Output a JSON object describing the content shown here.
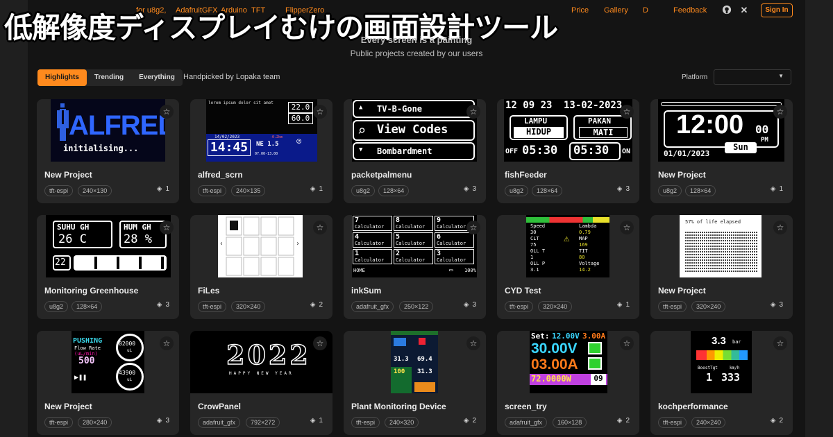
{
  "banner": {
    "text": "低解像度ディスプレイむけの画面設計ツール"
  },
  "nav": {
    "links": [
      "AdafruitGFX",
      "Arduino",
      "TFT",
      "FlipperZero",
      "Price",
      "Gallery",
      "Docs",
      "Feedback"
    ],
    "frag_left": "for u8g2,",
    "frag_docs": "D",
    "github": "github-icon",
    "x": "x-icon",
    "signin": "Sign In"
  },
  "hero": {
    "title": "Every screen is a painting",
    "subtitle": "Public projects created by our users"
  },
  "filters": {
    "tabs": [
      "Highlights",
      "Trending",
      "Everything"
    ],
    "active_tab": "Highlights",
    "caption": "Handpicked by Lopaka team",
    "platform_label": "Platform",
    "platform_value": ""
  },
  "colors": {
    "accent": "#ff8a1d",
    "background": "#141414",
    "card": "#262626"
  },
  "projects": [
    {
      "title": "New Project",
      "lib": "tft-espi",
      "size": "240×130",
      "count": "1",
      "screen": {
        "logo": "ALFRED",
        "sub": "initialising..."
      }
    },
    {
      "title": "alfred_scrn",
      "lib": "tft-espi",
      "size": "240×135",
      "count": "1",
      "screen": {
        "header": "lorem ipsum dolor sit amet",
        "v1": "22.0",
        "v2": "60.0",
        "date": "14/02/2023",
        "time": "14:45",
        "dir": "NE 1.5",
        "temp": "-0.2km",
        "range": "07.00-13.00"
      }
    },
    {
      "title": "packetpalmenu",
      "lib": "u8g2",
      "size": "128×64",
      "count": "3",
      "screen": {
        "items": [
          "TV-B-Gone",
          "View Codes",
          "Bombardment"
        ]
      }
    },
    {
      "title": "fishFeeder",
      "lib": "u8g2",
      "size": "128×64",
      "count": "3",
      "screen": {
        "time": "12 09 23",
        "date": "13-02-2023",
        "lamp": "LAMPU",
        "lamp_state": "HIDUP",
        "feed": "PAKAN",
        "feed_state": "MATI",
        "off_label": "OFF",
        "off_time": "05:30",
        "on_time": "05:30",
        "on_label": "ON"
      }
    },
    {
      "title": "New Project",
      "lib": "u8g2",
      "size": "128×64",
      "count": "1",
      "screen": {
        "time": "12:00",
        "sec": "00",
        "ampm": "PM",
        "date": "01/01/2023",
        "day": "Sun"
      }
    },
    {
      "title": "Monitoring Greenhouse",
      "lib": "u8g2",
      "size": "128×64",
      "count": "3",
      "screen": {
        "suhu": "SUHU GH",
        "suhu_val": "26 C",
        "hum": "HUM GH",
        "hum_val": "28 %",
        "num": "22"
      }
    },
    {
      "title": "FiLes",
      "lib": "tft-espi",
      "size": "320×240",
      "count": "2",
      "screen": {
        "prev": "‹",
        "next": "›"
      }
    },
    {
      "title": "inkSum",
      "lib": "adafruit_gfx",
      "size": "250×122",
      "count": "3",
      "screen": {
        "cells": [
          [
            "7",
            "Calculator"
          ],
          [
            "8",
            "Calculator"
          ],
          [
            "9",
            "Calculator"
          ],
          [
            "4",
            "Calculator"
          ],
          [
            "5",
            "Calculator"
          ],
          [
            "6",
            "Calculator"
          ],
          [
            "1",
            "Calculator"
          ],
          [
            "2",
            "Calculator"
          ],
          [
            "3",
            "Calculator"
          ]
        ],
        "home": "HOME",
        "battery": "100%"
      }
    },
    {
      "title": "CYD Test",
      "lib": "tft-espi",
      "size": "320×240",
      "count": "1",
      "screen": {
        "left": [
          "Speed",
          "30",
          "CLT",
          "75",
          "OLL T",
          "1",
          "OLL P",
          "3.1"
        ],
        "right": [
          "Lambda",
          "0.79",
          "MAP",
          "169",
          "TIT",
          "80",
          "Voltage",
          "14.2"
        ]
      }
    },
    {
      "title": "New Project",
      "lib": "tft-espi",
      "size": "320×240",
      "count": "3",
      "screen": {
        "header": "57% of life elapsed"
      }
    },
    {
      "title": "New Project",
      "lib": "tft-espi",
      "size": "280×240",
      "count": "3",
      "screen": {
        "state": "PUSHING",
        "flow_label": "Flow Rate",
        "flow_unit": "(uL/min)",
        "flow_val": "500",
        "g1": "02000",
        "g1u": "uL",
        "g2": "43900",
        "g2u": "uL"
      }
    },
    {
      "title": "CrowPanel",
      "lib": "adafruit_gfx",
      "size": "792×272",
      "count": "1",
      "screen": {
        "art": "2022",
        "caption": "HAPPY NEW YEAR"
      }
    },
    {
      "title": "Plant Monitoring Device",
      "lib": "tft-espi",
      "size": "240×320",
      "count": "2",
      "screen": {
        "a": "31.3",
        "b": "69.4",
        "c": "100",
        "d": "31.3"
      }
    },
    {
      "title": "screen_try",
      "lib": "adafruit_gfx",
      "size": "160×128",
      "count": "2",
      "screen": {
        "set": "Set:",
        "setv": "12.00V",
        "seta": "3.00A",
        "volt": "30.00V",
        "amp": "03.00A",
        "watt": "72.0000W",
        "num": "09"
      }
    },
    {
      "title": "kochperformance",
      "lib": "tft-espi",
      "size": "240×240",
      "count": "2",
      "screen": {
        "boost": "3.3",
        "unit": "bar",
        "l1": "BoostTgt",
        "v1": "1",
        "l2": "km/h",
        "v2": "333"
      }
    }
  ]
}
